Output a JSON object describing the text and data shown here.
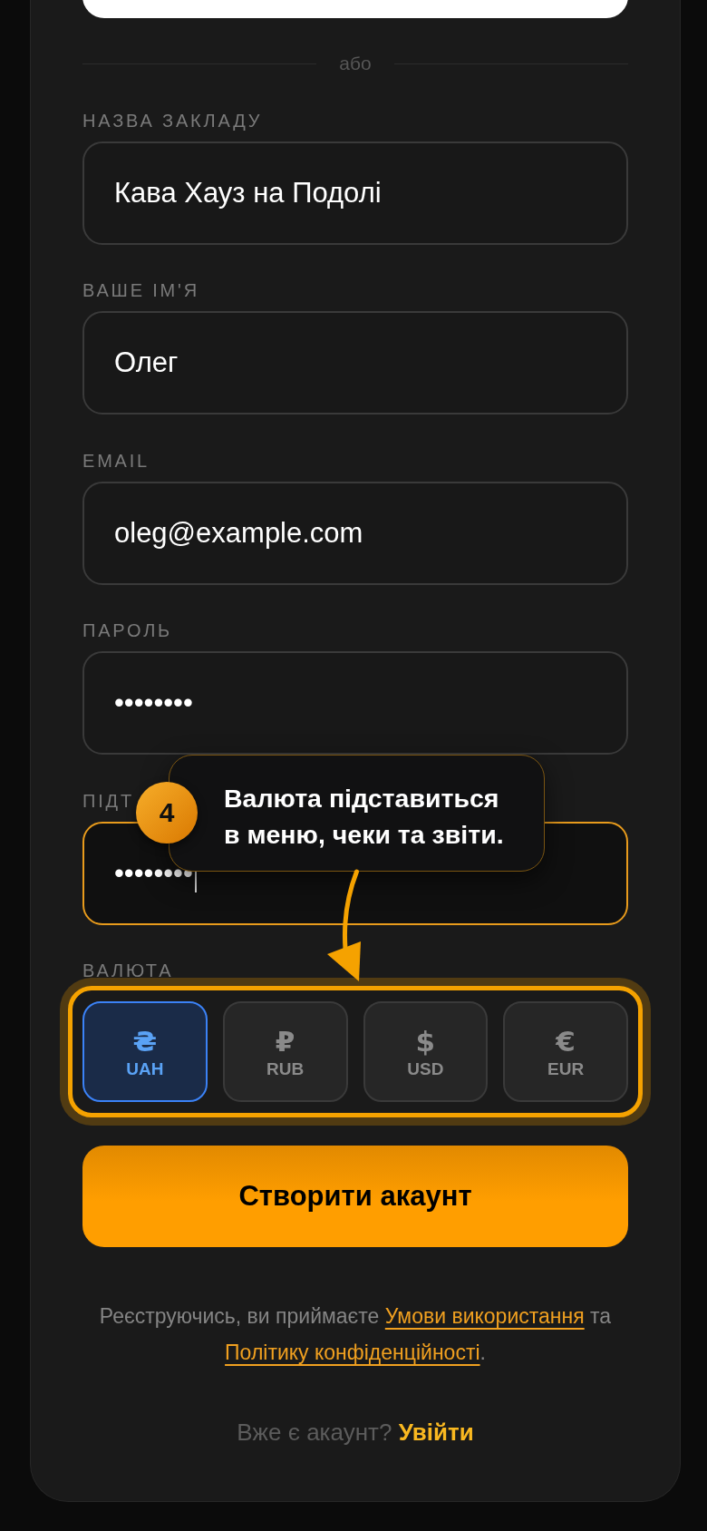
{
  "divider": {
    "text": "або"
  },
  "fields": [
    {
      "label": "НАЗВА ЗАКЛАДУ",
      "value": "Кава Хауз на Подолі",
      "focused": false
    },
    {
      "label": "ВАШЕ ІМ'Я",
      "value": "Олег",
      "focused": false
    },
    {
      "label": "EMAIL",
      "value": "oleg@example.com",
      "focused": false
    },
    {
      "label": "ПАРОЛЬ",
      "value": "••••••••",
      "focused": false
    },
    {
      "label": "ПІДТ",
      "value": "••••••••",
      "focused": true
    }
  ],
  "currency": {
    "label": "ВАЛЮТА",
    "highlighted": true,
    "options": [
      {
        "symbol": "₴",
        "code": "UAH",
        "selected": true
      },
      {
        "symbol": "₽",
        "code": "RUB",
        "selected": false
      },
      {
        "symbol": "$",
        "code": "USD",
        "selected": false
      },
      {
        "symbol": "€",
        "code": "EUR",
        "selected": false
      }
    ]
  },
  "submit_button": {
    "label": "Створити акаунт"
  },
  "terms": {
    "before": "Реєструючись, ви приймаєте",
    "terms_link": "Умови використання",
    "middle": "та",
    "privacy_link": "Політику конфіденційності",
    "after": "."
  },
  "login_prompt": {
    "text": "Вже є акаунт?",
    "link": "Увійти"
  },
  "tour_tip": {
    "step": "4",
    "text": "Валюта підставиться\nв меню, чеки та звіти."
  }
}
